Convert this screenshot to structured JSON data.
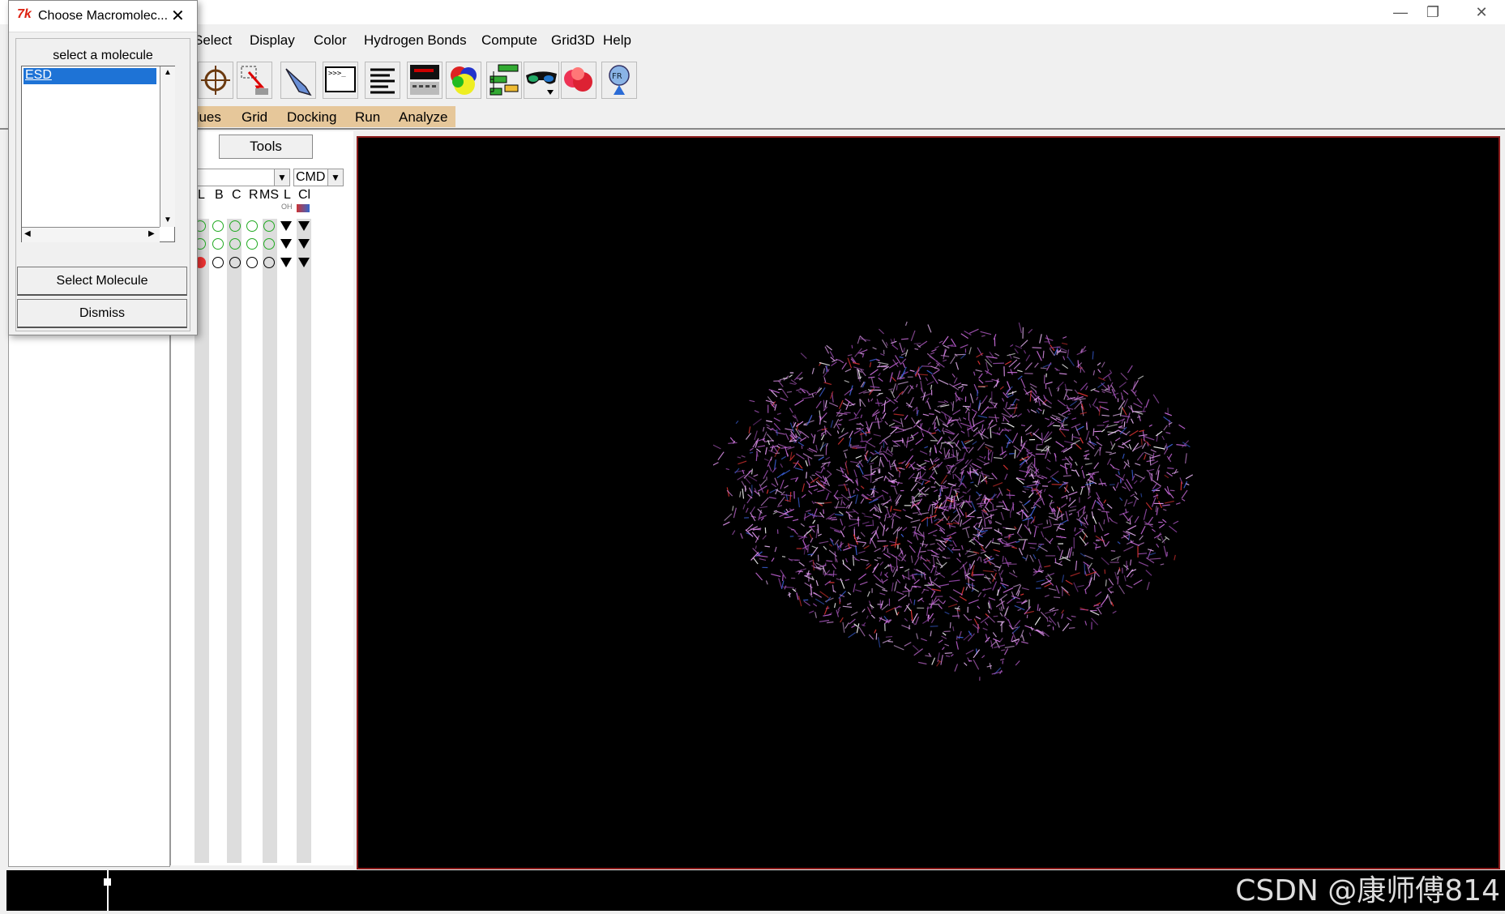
{
  "window": {
    "controls": {
      "minimize": "—",
      "restore": "❐",
      "close": "✕"
    }
  },
  "menu": {
    "items": [
      "Select",
      "Display",
      "Color",
      "Hydrogen Bonds",
      "Compute",
      "Grid3D",
      "Help"
    ]
  },
  "toolbar": {
    "icons": [
      "crosshair-icon",
      "select-cursor-icon",
      "pointer-hand-icon",
      "python-shell-icon",
      "text-align-icon",
      "display-panel-icon",
      "color-balls-icon",
      "tree-hierarchy-icon",
      "stereo-glasses-icon",
      "surface-icon",
      "adfr-icon"
    ]
  },
  "tabs": {
    "items": [
      "dues",
      "Grid",
      "Docking",
      "Run",
      "Analyze"
    ],
    "accent_color": "#e6c79a"
  },
  "dashboard": {
    "tools_label": "Tools",
    "cmd_label": "CMD",
    "column_headers": [
      "L",
      "B",
      "C",
      "R",
      "MS",
      "L",
      "Cl"
    ],
    "column_sublabels": [
      "OH"
    ]
  },
  "viewer": {
    "background": "#000000",
    "border_color": "#8a1a1a"
  },
  "status": {
    "watermark": "CSDN @康师傅814"
  },
  "dialog": {
    "title": "Choose Macromolec...",
    "app_icon": "7k",
    "close_glyph": "✕",
    "prompt": "select a molecule",
    "list_items": [
      "ESD"
    ],
    "selected_item": "ESD",
    "select_button": "Select Molecule",
    "dismiss_button": "Dismiss"
  }
}
